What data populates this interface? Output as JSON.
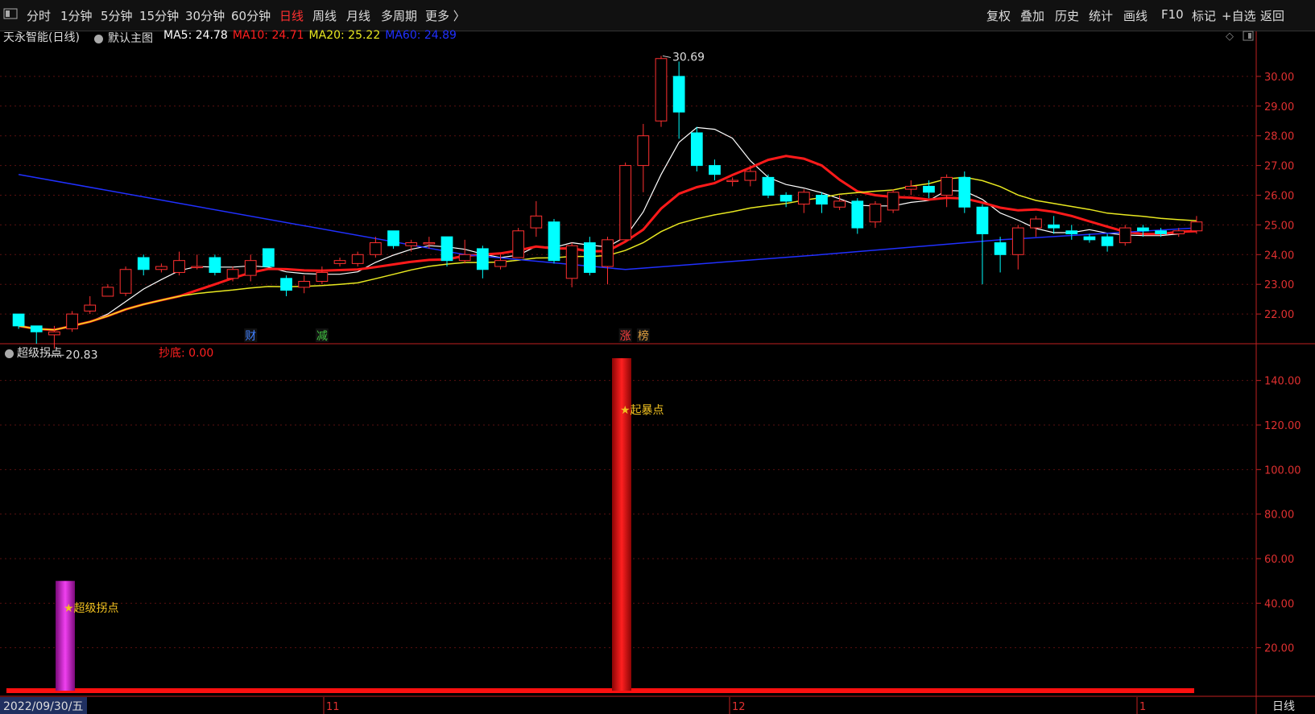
{
  "toolbar": {
    "left_icon": "panel-toggle-icon",
    "periods": [
      "分时",
      "1分钟",
      "5分钟",
      "15分钟",
      "30分钟",
      "60分钟",
      "日线",
      "周线",
      "月线",
      "多周期",
      "更多 〉"
    ],
    "active_period": "日线",
    "right_items": [
      "复权",
      "叠加",
      "历史",
      "统计",
      "画线",
      "F10",
      "标记",
      "+自选",
      "返回"
    ]
  },
  "stock": {
    "name": "天永智能(日线)",
    "main_chart": "默认主图",
    "ma": [
      {
        "label": "MA5: 24.78",
        "color": "#ffffff"
      },
      {
        "label": "MA10: 24.71",
        "color": "#ff2020"
      },
      {
        "label": "MA20: 25.22",
        "color": "#e8e820"
      },
      {
        "label": "MA60: 24.89",
        "color": "#2030ff"
      }
    ]
  },
  "price_axis": {
    "ticks": [
      "30.00",
      "29.00",
      "28.00",
      "27.00",
      "26.00",
      "25.00",
      "24.00",
      "23.00",
      "22.00"
    ],
    "high_label": "30.69",
    "low_label": "20.83"
  },
  "markers": [
    {
      "text": "财",
      "color": "#4080ff"
    },
    {
      "text": "减",
      "color": "#40c040"
    },
    {
      "text": "涨",
      "color": "#ff4040"
    },
    {
      "text": "榜",
      "color": "#e0a040"
    }
  ],
  "indicator": {
    "name": "超级拐点",
    "param": "抄底: 0.00",
    "ticks": [
      "140.00",
      "120.00",
      "100.00",
      "80.00",
      "60.00",
      "40.00",
      "20.00"
    ],
    "bars": [
      {
        "label": "★超级拐点",
        "value": 50,
        "color": "#d020d0"
      },
      {
        "label": "★起暴点",
        "value": 150,
        "color": "#ee1010"
      }
    ]
  },
  "date_axis": {
    "current_date": "2022/09/30/五",
    "months": [
      "11",
      "12",
      "1"
    ],
    "period_label": "日线"
  },
  "chart_data": {
    "type": "candlestick",
    "candles": [
      [
        22.0,
        21.6,
        21.5,
        22.0
      ],
      [
        21.6,
        21.4,
        21.0,
        21.6
      ],
      [
        21.3,
        21.4,
        20.83,
        21.6
      ],
      [
        21.5,
        22.0,
        21.4,
        22.1
      ],
      [
        22.1,
        22.3,
        22.0,
        22.6
      ],
      [
        22.6,
        22.9,
        22.6,
        23.0
      ],
      [
        22.7,
        23.5,
        22.6,
        23.6
      ],
      [
        23.9,
        23.5,
        23.3,
        24.0
      ],
      [
        23.5,
        23.6,
        23.4,
        23.7
      ],
      [
        23.4,
        23.8,
        23.3,
        24.1
      ],
      [
        23.6,
        23.6,
        23.5,
        24.0
      ],
      [
        23.9,
        23.4,
        23.3,
        24.0
      ],
      [
        23.2,
        23.5,
        23.1,
        23.6
      ],
      [
        23.3,
        23.8,
        23.1,
        24.0
      ],
      [
        24.2,
        23.6,
        23.6,
        24.2
      ],
      [
        23.2,
        22.8,
        22.6,
        23.3
      ],
      [
        22.9,
        23.1,
        22.7,
        23.3
      ],
      [
        23.1,
        23.4,
        23.0,
        23.6
      ],
      [
        23.7,
        23.8,
        23.6,
        23.9
      ],
      [
        23.7,
        24.0,
        23.6,
        24.1
      ],
      [
        24.0,
        24.4,
        23.9,
        24.6
      ],
      [
        24.8,
        24.3,
        24.2,
        24.8
      ],
      [
        24.3,
        24.4,
        24.1,
        24.5
      ],
      [
        24.4,
        24.4,
        24.2,
        24.6
      ],
      [
        24.6,
        23.8,
        23.6,
        24.6
      ],
      [
        23.8,
        24.0,
        23.7,
        24.5
      ],
      [
        24.2,
        23.5,
        23.2,
        24.3
      ],
      [
        23.6,
        23.8,
        23.5,
        24.0
      ],
      [
        23.9,
        24.8,
        23.9,
        24.9
      ],
      [
        24.9,
        25.3,
        24.6,
        25.8
      ],
      [
        25.1,
        23.8,
        23.7,
        25.2
      ],
      [
        23.2,
        24.3,
        22.9,
        24.4
      ],
      [
        24.4,
        23.4,
        23.3,
        24.6
      ],
      [
        23.6,
        24.5,
        23.0,
        24.6
      ],
      [
        24.5,
        27.0,
        24.5,
        27.1
      ],
      [
        27.0,
        28.0,
        26.1,
        28.4
      ],
      [
        28.5,
        30.6,
        28.3,
        30.69
      ],
      [
        30.0,
        28.8,
        27.9,
        30.5
      ],
      [
        28.1,
        27.0,
        26.8,
        28.3
      ],
      [
        27.0,
        26.7,
        26.5,
        27.2
      ],
      [
        26.5,
        26.5,
        26.3,
        26.6
      ],
      [
        26.5,
        26.8,
        26.3,
        27.0
      ],
      [
        26.6,
        26.0,
        25.9,
        26.7
      ],
      [
        26.0,
        25.8,
        25.6,
        26.1
      ],
      [
        25.7,
        26.1,
        25.4,
        26.2
      ],
      [
        26.0,
        25.7,
        25.4,
        26.1
      ],
      [
        25.6,
        25.8,
        25.5,
        26.0
      ],
      [
        25.8,
        24.9,
        24.7,
        25.9
      ],
      [
        25.1,
        25.7,
        24.9,
        25.8
      ],
      [
        25.5,
        26.1,
        25.4,
        26.2
      ],
      [
        26.2,
        26.3,
        26.0,
        26.5
      ],
      [
        26.3,
        26.1,
        25.9,
        26.5
      ],
      [
        26.0,
        26.6,
        25.6,
        26.7
      ],
      [
        26.6,
        25.6,
        25.4,
        26.8
      ],
      [
        25.6,
        24.7,
        23.0,
        25.7
      ],
      [
        24.4,
        24.0,
        23.4,
        24.6
      ],
      [
        24.0,
        24.9,
        23.5,
        25.0
      ],
      [
        24.9,
        25.2,
        24.6,
        25.3
      ],
      [
        25.0,
        24.9,
        24.7,
        25.3
      ],
      [
        24.8,
        24.7,
        24.5,
        25.0
      ],
      [
        24.6,
        24.5,
        24.4,
        24.7
      ],
      [
        24.6,
        24.3,
        24.1,
        24.7
      ],
      [
        24.4,
        24.9,
        24.3,
        25.0
      ],
      [
        24.9,
        24.8,
        24.6,
        25.0
      ],
      [
        24.8,
        24.7,
        24.6,
        24.9
      ],
      [
        24.7,
        24.8,
        24.6,
        24.9
      ],
      [
        24.8,
        25.1,
        24.7,
        25.3
      ]
    ],
    "ylim": [
      21.0,
      31.0
    ],
    "indicator_ylim": [
      0,
      150
    ],
    "indicator_bar_index": [
      3,
      33
    ]
  }
}
